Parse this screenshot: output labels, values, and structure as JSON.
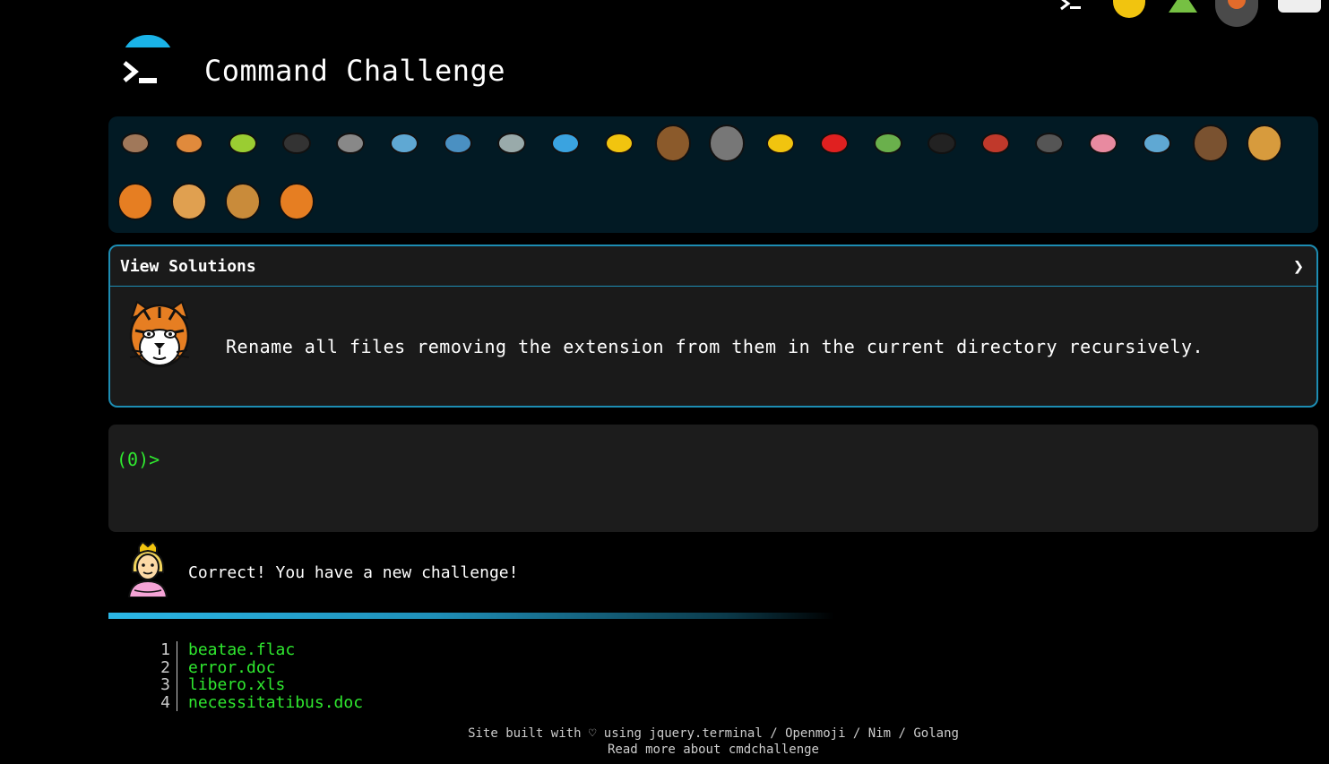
{
  "header": {
    "title": "Command Challenge",
    "logo_prompt": ">_"
  },
  "top_icons": [
    "terminal-icon",
    "lightbulb-icon",
    "tree-icon",
    "shield-icon",
    "mail-icon"
  ],
  "animals": {
    "row1": [
      "snail",
      "butterfly",
      "caterpillar",
      "ant",
      "spider-web",
      "whale",
      "dolphin",
      "dolphin-gray",
      "fish",
      "tropical-fish",
      "blowfish",
      "wolf",
      "bee",
      "ladybug",
      "cricket",
      "spider",
      "scorpion",
      "fly",
      "worm",
      "microbe",
      "monkey",
      "dog"
    ],
    "row2": [
      "fox",
      "cat",
      "lion",
      "tiger"
    ]
  },
  "solutions": {
    "header_label": "View Solutions",
    "chevron": "❯",
    "challenge_text": "Rename all files removing the extension from them in the current directory recursively."
  },
  "terminal": {
    "prompt": "(0)>"
  },
  "feedback": {
    "message": "Correct! You have a new challenge!"
  },
  "progress": {
    "fill": 0.55
  },
  "files": [
    {
      "num": "1",
      "name": "beatae.flac"
    },
    {
      "num": "2",
      "name": "error.doc"
    },
    {
      "num": "3",
      "name": "libero.xls"
    },
    {
      "num": "4",
      "name": "necessitatibus.doc"
    }
  ],
  "footer": {
    "line1": "Site built with ♡ using jquery.terminal / Openmoji / Nim / Golang",
    "line2": "Read more about cmdchallenge"
  },
  "colors": {
    "accent": "#1d8db3",
    "prompt_green": "#2fe82f",
    "panel_bg": "#021a24"
  }
}
